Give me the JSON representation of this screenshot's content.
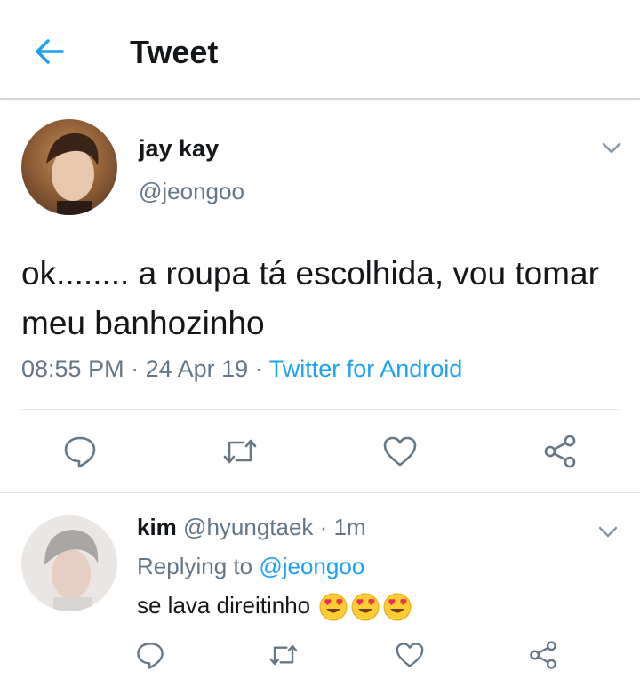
{
  "header": {
    "title": "Tweet"
  },
  "tweet": {
    "display_name": "jay kay",
    "handle": "@jeongoo",
    "text": "ok........ a roupa tá escolhida, vou tomar meu banhozinho",
    "time": "08:55 PM",
    "date": "24 Apr 19",
    "source": "Twitter for Android",
    "separator": " · "
  },
  "reply": {
    "display_name": "kim",
    "handle": "@hyungtaek",
    "time": "1m",
    "replying_prefix": "Replying to ",
    "replying_to": "@jeongoo",
    "text": "se lava direitinho",
    "emoji_count": 3
  },
  "icons": {
    "back": "arrow-left-icon",
    "caret": "chevron-down-icon",
    "reply": "comment-bubble-icon",
    "retweet": "retweet-icon",
    "like": "heart-icon",
    "share": "share-icon",
    "emoji": "smiling-face-with-heart-eyes-emoji"
  },
  "colors": {
    "accent": "#1da1f2",
    "secondary_text": "#657786",
    "icon": "#657786",
    "divider": "#e1e8ed"
  }
}
